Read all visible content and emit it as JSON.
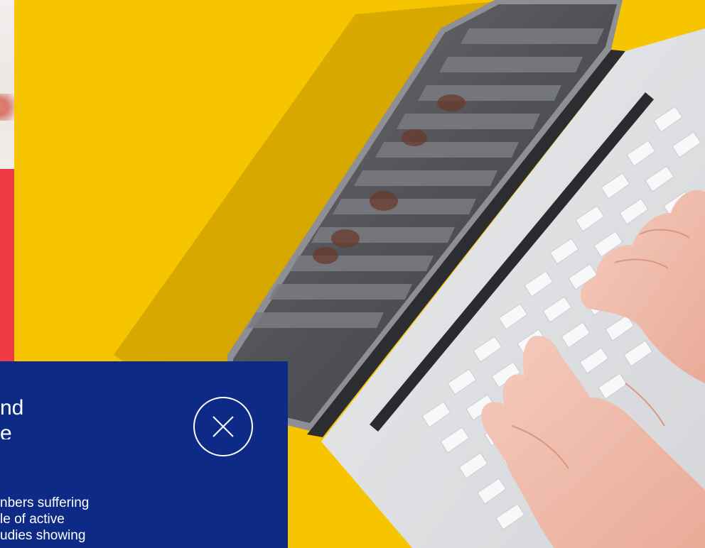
{
  "card": {
    "title_line1": "nd",
    "title_line2": "e",
    "body_lines": [
      "nbers suffering",
      "le of active",
      "udies showing"
    ],
    "close_label": "Close"
  },
  "colors": {
    "hero_background": "#f7c400",
    "card_background": "#0d2a86",
    "accent_red": "#ef3b45",
    "text": "#ffffff"
  },
  "icons": {
    "close": "close-circle-icon"
  }
}
